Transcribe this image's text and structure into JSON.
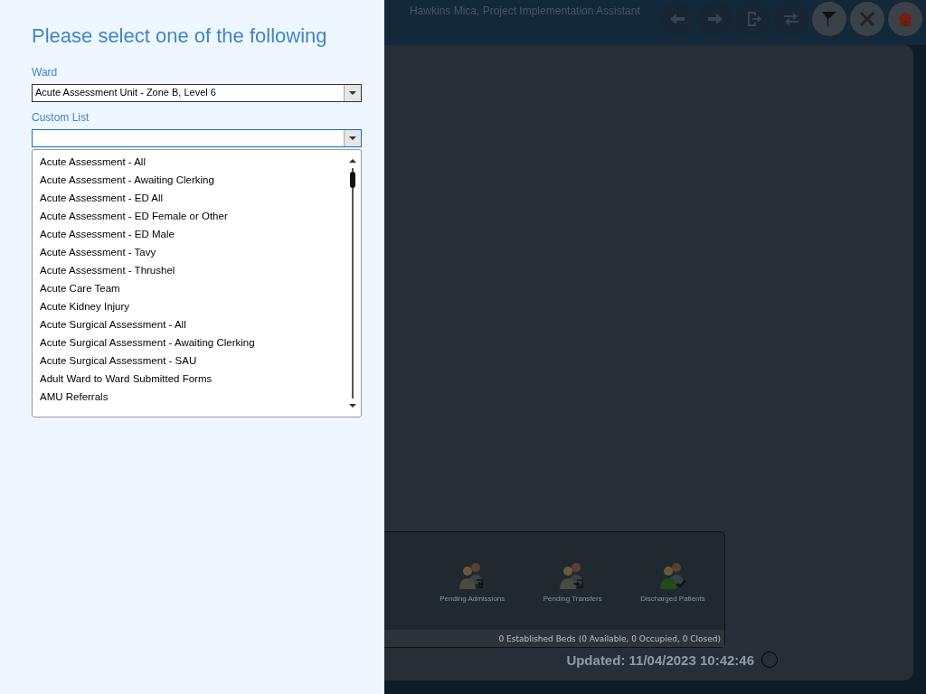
{
  "header": {
    "user": "Hawkins Mica, Project Implementation Assistant",
    "buttons": [
      {
        "kind": "back",
        "disabled": true
      },
      {
        "kind": "forward",
        "disabled": true
      },
      {
        "kind": "export",
        "disabled": true
      },
      {
        "kind": "swap",
        "disabled": true
      },
      {
        "kind": "filter",
        "disabled": false
      },
      {
        "kind": "close",
        "disabled": false
      },
      {
        "kind": "home",
        "disabled": false
      }
    ]
  },
  "dashboard": {
    "tiles": [
      {
        "kind": "admissions",
        "label": "Pending Admissions"
      },
      {
        "kind": "transfers",
        "label": "Pending Transfers"
      },
      {
        "kind": "discharged",
        "label": "Discharged Patients"
      }
    ],
    "beds": "0 Established Beds (0 Available, 0 Occupied, 0 Closed)",
    "updated": "Updated: 11/04/2023 10:42:46"
  },
  "selector": {
    "title": "Please select one of the following",
    "ward": {
      "label": "Ward",
      "value": "Acute Assessment Unit - Zone B, Level 6"
    },
    "custom_list": {
      "label": "Custom List",
      "options": [
        "Acute Assessment - All",
        "Acute Assessment - Awaiting Clerking",
        "Acute Assessment - ED All",
        "Acute Assessment - ED Female or Other",
        "Acute Assessment - ED Male",
        "Acute Assessment - Tavy",
        "Acute Assessment - Thrushel",
        "Acute Care Team",
        "Acute Kidney Injury",
        "Acute Surgical Assessment - All",
        "Acute Surgical Assessment - Awaiting Clerking",
        "Acute Surgical Assessment - SAU",
        "Adult Ward to Ward Submitted Forms",
        "AMU Referrals"
      ]
    }
  }
}
